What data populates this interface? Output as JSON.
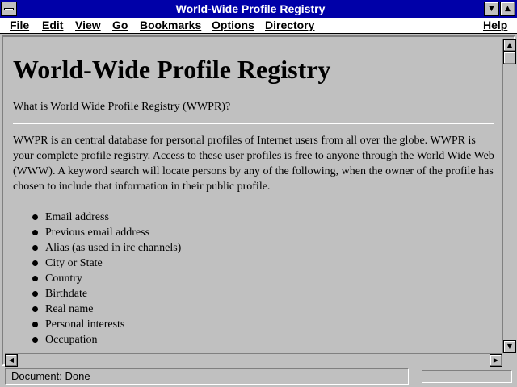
{
  "window": {
    "title": "World-Wide Profile Registry"
  },
  "menu": {
    "items": [
      "File",
      "Edit",
      "View",
      "Go",
      "Bookmarks",
      "Options",
      "Directory",
      "Help"
    ]
  },
  "page": {
    "heading": "World-Wide Profile Registry",
    "question": "What is World Wide Profile Registry (WWPR)?",
    "paragraph": "WWPR is an central database for personal profiles of Internet users from all over the globe. WWPR is your complete profile registry. Access to these user profiles is free to anyone through the World Wide Web (WWW). A keyword search will locate persons by any of the following, when the owner of the profile has chosen to include that information in their public profile.",
    "list": [
      "Email address",
      "Previous email address",
      "Alias (as used in irc channels)",
      "City or State",
      "Country",
      "Birthdate",
      "Real name",
      "Personal interests",
      "Occupation"
    ]
  },
  "status": {
    "text": "Document: Done"
  },
  "icons": {
    "system_menu": "system-menu-icon",
    "minimize": "minimize-icon",
    "maximize": "maximize-icon",
    "scroll_up": "arrow-up-icon",
    "scroll_down": "arrow-down-icon",
    "scroll_left": "arrow-left-icon",
    "scroll_right": "arrow-right-icon",
    "bullet": "bullet-icon"
  },
  "colors": {
    "titlebar": "#0000a8",
    "window": "#c0c0c0",
    "menubar": "#ffffff"
  }
}
